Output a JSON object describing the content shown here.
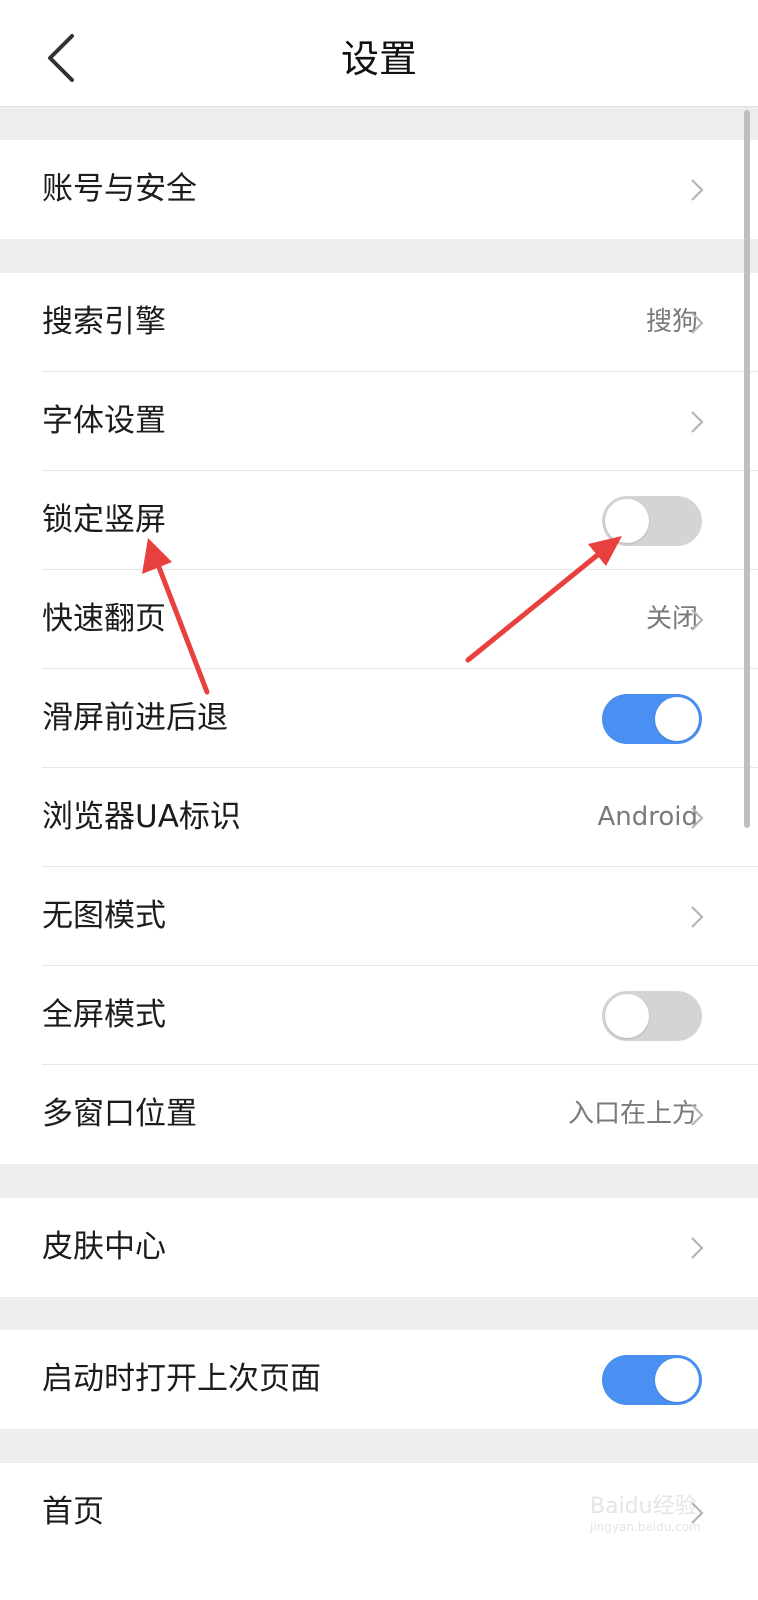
{
  "header": {
    "title": "设置",
    "back_icon": "chevron-left-icon"
  },
  "groups": [
    {
      "items": [
        {
          "label": "账号与安全",
          "type": "link"
        }
      ]
    },
    {
      "items": [
        {
          "label": "搜索引擎",
          "type": "link",
          "value": "搜狗"
        },
        {
          "label": "字体设置",
          "type": "link"
        },
        {
          "label": "锁定竖屏",
          "type": "toggle",
          "on": false
        },
        {
          "label": "快速翻页",
          "type": "link",
          "value": "关闭"
        },
        {
          "label": "滑屏前进后退",
          "type": "toggle",
          "on": true
        },
        {
          "label": "浏览器UA标识",
          "type": "link",
          "value": "Android"
        },
        {
          "label": "无图模式",
          "type": "link"
        },
        {
          "label": "全屏模式",
          "type": "toggle",
          "on": false
        },
        {
          "label": "多窗口位置",
          "type": "link",
          "value": "入口在上方"
        }
      ]
    },
    {
      "items": [
        {
          "label": "皮肤中心",
          "type": "link"
        }
      ]
    },
    {
      "items": [
        {
          "label": "启动时打开上次页面",
          "type": "toggle",
          "on": true
        }
      ]
    },
    {
      "items": [
        {
          "label": "首页",
          "type": "link"
        }
      ]
    }
  ],
  "colors": {
    "toggle_on": "#4a90f2",
    "toggle_off": "#d4d4d4",
    "annotation_arrow": "#e8403e"
  },
  "watermark": {
    "text": "Baidu经验",
    "subtext": "jingyan.baidu.com"
  }
}
